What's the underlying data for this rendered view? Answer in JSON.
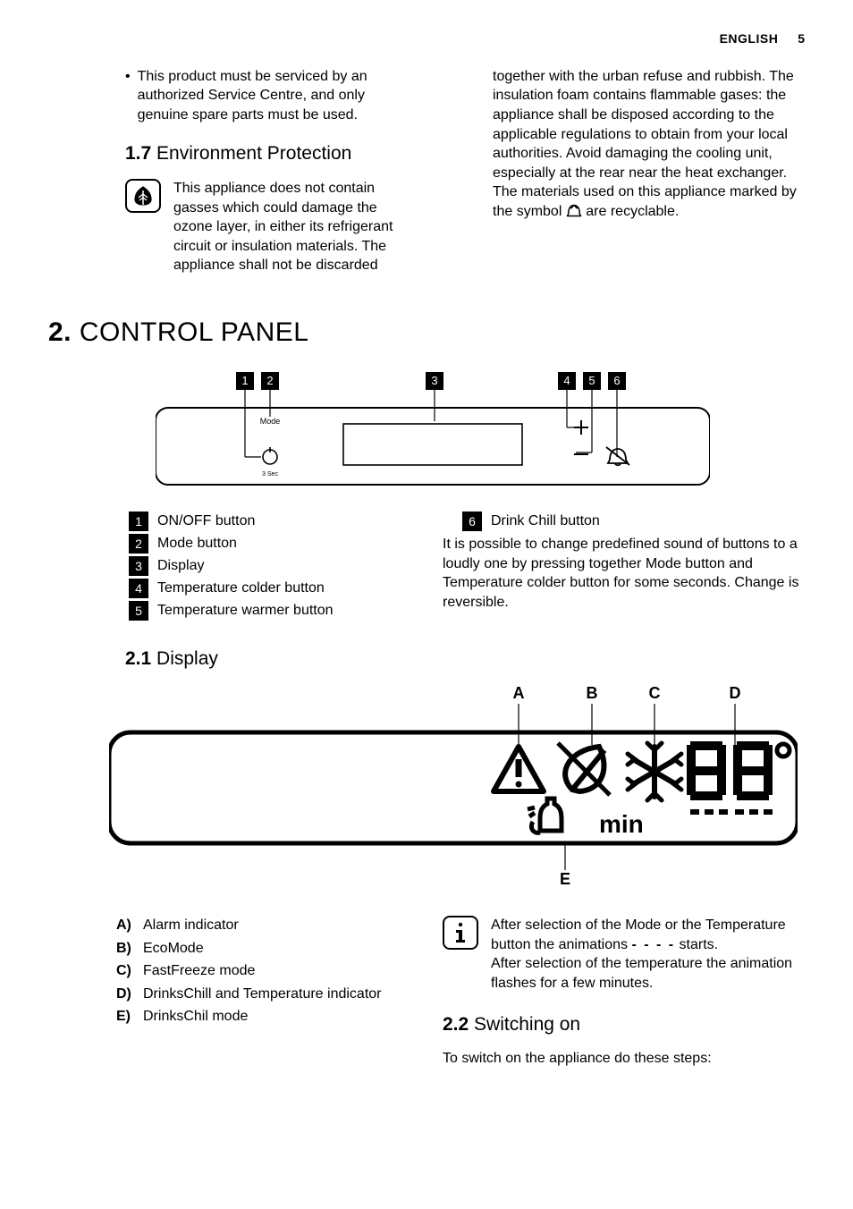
{
  "header": {
    "language": "ENGLISH",
    "page_number": "5"
  },
  "top_left": {
    "bullet": "This product must be serviced by an authorized Service Centre, and only genuine spare parts must be used.",
    "subhead_num": "1.7",
    "subhead_title": "Environment Protection",
    "env_icon": "leaf-icon",
    "env_text": "This appliance does not contain gasses which could damage the ozone layer, in either its refrigerant circuit or insulation materials. The appliance shall not be discarded"
  },
  "top_right": {
    "text_before": "together with the urban refuse and rubbish. The insulation foam contains flammable gases: the appliance shall be disposed according to the applicable regulations to obtain from your local authorities. Avoid damaging the cooling unit, especially at the rear near the heat exchanger. The materials used on this appliance marked by the symbol ",
    "text_after": " are recyclable.",
    "recycle_icon": "recycle-icon"
  },
  "section2": {
    "num": "2.",
    "title": "CONTROL PANEL"
  },
  "panel": {
    "callouts": [
      "1",
      "2",
      "3",
      "4",
      "5",
      "6"
    ],
    "mode_label": "Mode",
    "clock_label": "3 Sec"
  },
  "legend": {
    "items": [
      {
        "n": "1",
        "t": "ON/OFF button"
      },
      {
        "n": "2",
        "t": "Mode button"
      },
      {
        "n": "3",
        "t": "Display"
      },
      {
        "n": "4",
        "t": "Temperature colder button"
      },
      {
        "n": "5",
        "t": "Temperature warmer button"
      }
    ],
    "right_item": {
      "n": "6",
      "t": "Drink Chill button"
    },
    "right_note": "It is possible to change predefined sound of buttons to a loudly one by pressing together Mode button and Temperature colder button for some seconds. Change is reversible."
  },
  "display_head": {
    "num": "2.1",
    "title": "Display"
  },
  "display_letters": [
    "A",
    "B",
    "C",
    "D",
    "E"
  ],
  "display_defs": [
    {
      "l": "A)",
      "t": "Alarm indicator"
    },
    {
      "l": "B)",
      "t": "EcoMode"
    },
    {
      "l": "C)",
      "t": "FastFreeze mode"
    },
    {
      "l": "D)",
      "t": "DrinksChill and Temperature indicator"
    },
    {
      "l": "E)",
      "t": "DrinksChil mode"
    }
  ],
  "info_note": {
    "line1": "After selection of the Mode or the Temperature button the animations ",
    "dashes": "- - - -",
    "line1_end": " starts.",
    "line2": "After selection of the temperature the animation flashes for a few minutes."
  },
  "switching": {
    "num": "2.2",
    "title": "Switching on",
    "para": "To switch on the appliance do these steps:"
  }
}
